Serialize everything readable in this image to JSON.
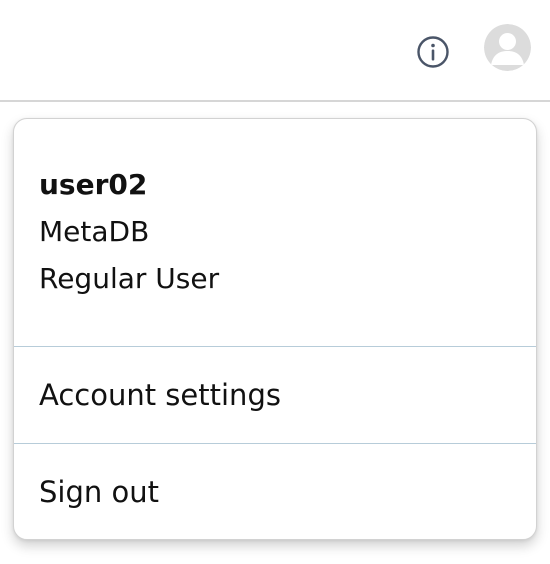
{
  "topbar": {
    "icons": {
      "info": "info-icon",
      "avatar": "avatar-icon"
    }
  },
  "menu": {
    "user": {
      "username": "user02",
      "organization": "MetaDB",
      "role": "Regular User"
    },
    "items": [
      {
        "label": "Account settings"
      },
      {
        "label": "Sign out"
      }
    ]
  },
  "colors": {
    "icon": "#4a5568",
    "avatar_bg": "#dcdcdc",
    "avatar_fg": "#ffffff",
    "divider": "#b7ccd9"
  }
}
